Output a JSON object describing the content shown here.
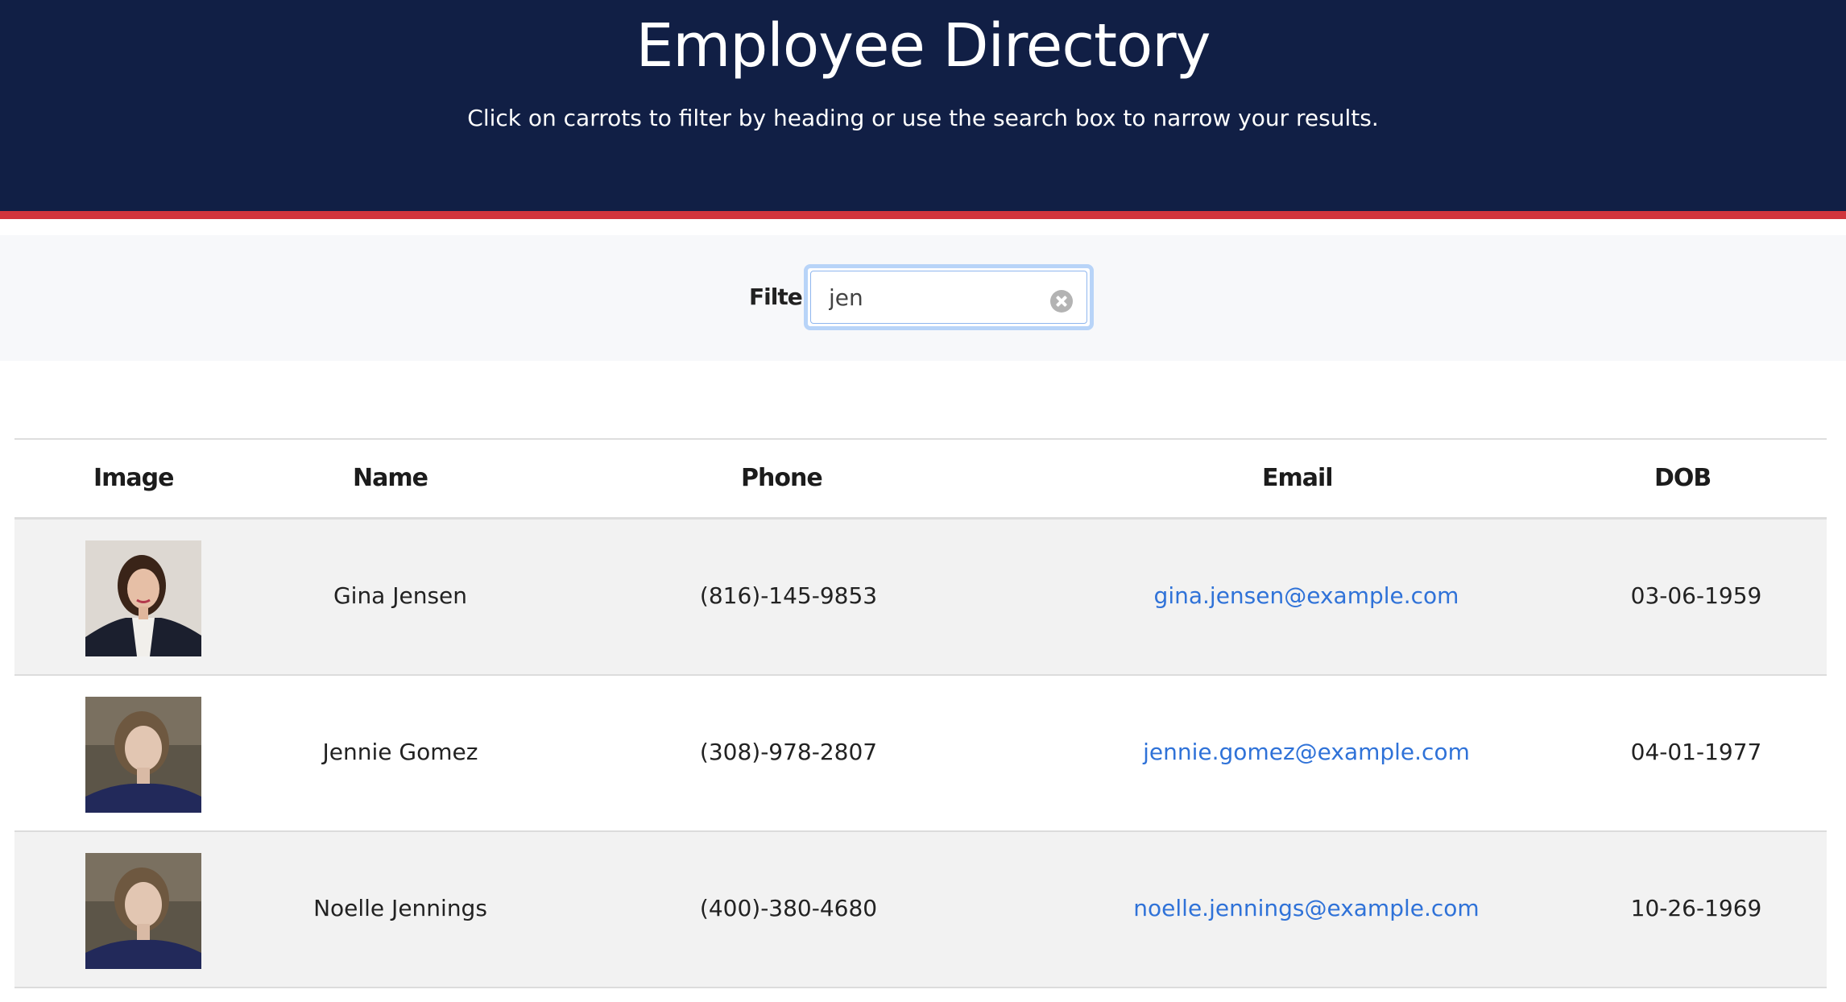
{
  "header": {
    "title": "Employee Directory",
    "subtitle": "Click on carrots to filter by heading or use the search box to narrow your results.",
    "background_color": "#111f45",
    "stripe_color": "#d1343c"
  },
  "filter": {
    "label": "Filter:",
    "value": "jen"
  },
  "table": {
    "columns": [
      "Image",
      "Name",
      "Phone",
      "Email",
      "DOB"
    ],
    "rows": [
      {
        "name": "Gina Jensen",
        "phone": "(816)-145-9853",
        "email": "gina.jensen@example.com",
        "dob": "03-06-1959",
        "avatar_icon": "woman-portrait-dark-hair"
      },
      {
        "name": "Jennie Gomez",
        "phone": "(308)-978-2807",
        "email": "jennie.gomez@example.com",
        "dob": "04-01-1977",
        "avatar_icon": "woman-portrait-outdoor"
      },
      {
        "name": "Noelle Jennings",
        "phone": "(400)-380-4680",
        "email": "noelle.jennings@example.com",
        "dob": "10-26-1969",
        "avatar_icon": "woman-portrait-outdoor"
      }
    ],
    "link_color": "#2f72d8"
  }
}
